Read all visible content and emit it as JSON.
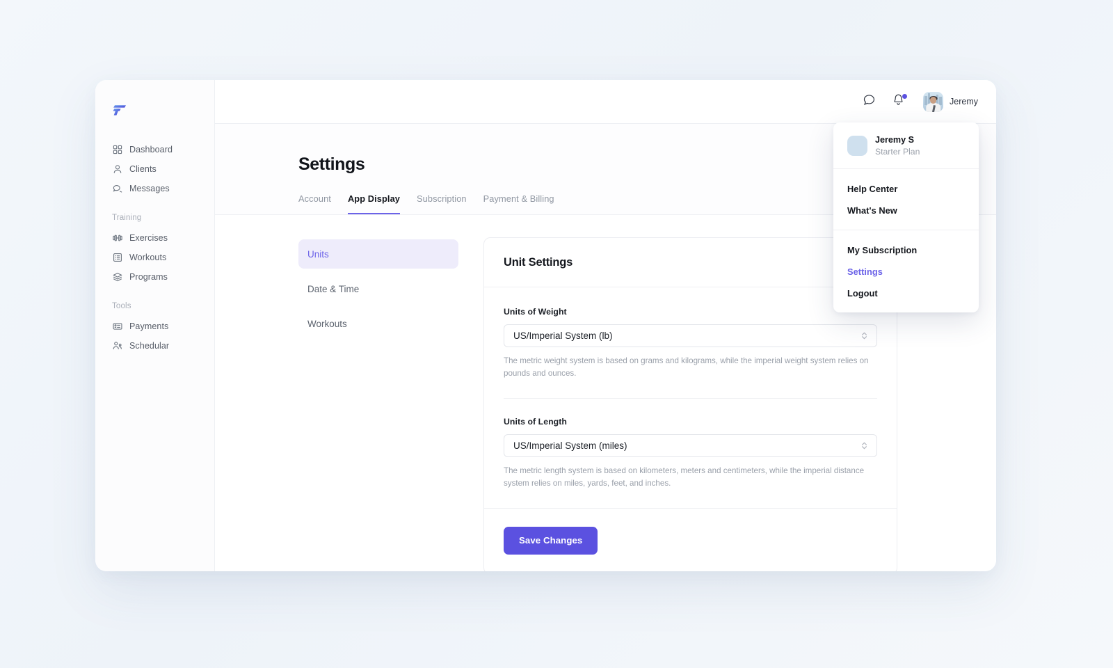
{
  "brand": {
    "logo_name": "fitness-app-logo",
    "accent": "#5b51e0",
    "accent_soft": "#6c63e8"
  },
  "sidebar": {
    "primary": [
      {
        "label": "Dashboard",
        "icon": "grid-icon"
      },
      {
        "label": "Clients",
        "icon": "user-icon"
      },
      {
        "label": "Messages",
        "icon": "chat-bubbles-icon"
      }
    ],
    "sections": [
      {
        "title": "Training",
        "items": [
          {
            "label": "Exercises",
            "icon": "dumbbell-icon"
          },
          {
            "label": "Workouts",
            "icon": "list-document-icon"
          },
          {
            "label": "Programs",
            "icon": "layers-icon"
          }
        ]
      },
      {
        "title": "Tools",
        "items": [
          {
            "label": "Payments",
            "icon": "credit-card-icon"
          },
          {
            "label": "Schedular",
            "icon": "user-network-icon"
          }
        ]
      }
    ]
  },
  "topbar": {
    "messages_icon": "chat-bubble-icon",
    "notifications_icon": "bell-icon",
    "has_notification": true,
    "user_name": "Jeremy",
    "avatar_name": "user-avatar"
  },
  "user_menu": {
    "profile": {
      "name": "Jeremy S",
      "plan": "Starter Plan"
    },
    "groups": [
      {
        "items": [
          {
            "label": "Help Center",
            "active": false
          },
          {
            "label": "What's New",
            "active": false
          }
        ]
      },
      {
        "items": [
          {
            "label": "My Subscription",
            "active": false
          },
          {
            "label": "Settings",
            "active": true
          },
          {
            "label": "Logout",
            "active": false
          }
        ]
      }
    ]
  },
  "page": {
    "title": "Settings",
    "tabs": [
      {
        "label": "Account",
        "active": false
      },
      {
        "label": "App Display",
        "active": true
      },
      {
        "label": "Subscription",
        "active": false
      },
      {
        "label": "Payment & Billing",
        "active": false
      }
    ]
  },
  "subnav": [
    {
      "label": "Units",
      "active": true
    },
    {
      "label": "Date & Time",
      "active": false
    },
    {
      "label": "Workouts",
      "active": false
    }
  ],
  "card": {
    "title": "Unit Settings",
    "fields": [
      {
        "label": "Units of Weight",
        "value": "US/Imperial System (lb)",
        "help": "The metric weight system is based on grams and kilograms, while the imperial weight system relies on pounds and ounces."
      },
      {
        "label": "Units of Length",
        "value": "US/Imperial System (miles)",
        "help": "The metric length system is based on kilometers, meters and centimeters, while the imperial distance system relies on miles, yards, feet, and inches."
      }
    ],
    "save_label": "Save Changes"
  }
}
